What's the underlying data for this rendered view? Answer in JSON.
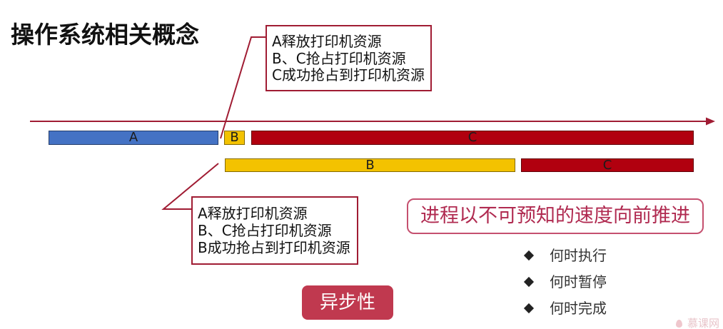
{
  "slide": {
    "title": "操作系统相关概念"
  },
  "timeline": {
    "row1": [
      {
        "label": "A",
        "color": "#4472c4"
      },
      {
        "label": "B",
        "color": "#f3c200"
      },
      {
        "label": "C",
        "color": "#b1000f"
      }
    ],
    "row2": [
      {
        "label": "B",
        "color": "#f3c200"
      },
      {
        "label": "C",
        "color": "#b1000f"
      }
    ]
  },
  "callout_top": {
    "lines": [
      "A释放打印机资源",
      "B、C抢占打印机资源",
      "C成功抢占到打印机资源"
    ]
  },
  "callout_bottom": {
    "lines": [
      "A释放打印机资源",
      "B、C抢占打印机资源",
      "B成功抢占到打印机资源"
    ]
  },
  "statement": "进程以不可预知的速度向前推进",
  "bullets": [
    {
      "icon": "diamond-icon",
      "text": "何时执行"
    },
    {
      "icon": "diamond-icon",
      "text": "何时暂停"
    },
    {
      "icon": "diamond-icon",
      "text": "何时完成"
    }
  ],
  "badge": "异步性",
  "watermark": "慕课网",
  "colors": {
    "accent": "#a01c33",
    "statement_text": "#b02a50",
    "badge_fill": "#c0394f"
  }
}
